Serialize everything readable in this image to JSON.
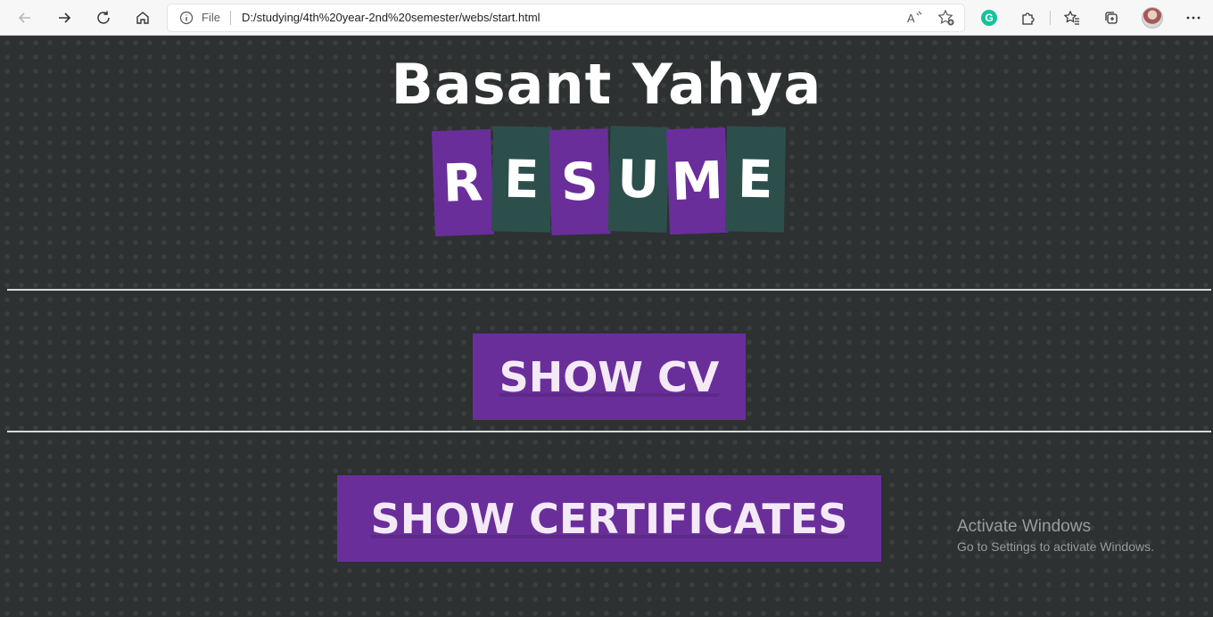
{
  "browser": {
    "address": {
      "scheme_label": "File",
      "url": "D:/studying/4th%20year-2nd%20semester/webs/start.html"
    },
    "icons": {
      "back": "arrow-left-icon",
      "forward": "arrow-right-icon",
      "refresh": "refresh-icon",
      "home": "home-icon",
      "info": "info-icon",
      "read_aloud": "read-aloud-icon",
      "favorite": "star-add-icon",
      "grammarly": "grammarly-icon",
      "extensions": "puzzle-icon",
      "favorites": "favorites-icon",
      "collections": "collections-icon",
      "profile": "avatar",
      "menu": "more-icon"
    },
    "grammarly_letter": "G"
  },
  "page": {
    "name": "Basant Yahya",
    "resume_letters": [
      "R",
      "E",
      "S",
      "U",
      "M",
      "E"
    ],
    "show_cv_label": "SHOW CV",
    "show_certificates_label": "SHOW CERTIFICATES",
    "colors": {
      "background": "#2d3132",
      "purple": "#6a2e9b",
      "green": "#2c4f4b",
      "text": "#ffffff"
    }
  },
  "watermark": {
    "line1": "Activate Windows",
    "line2": "Go to Settings to activate Windows."
  }
}
